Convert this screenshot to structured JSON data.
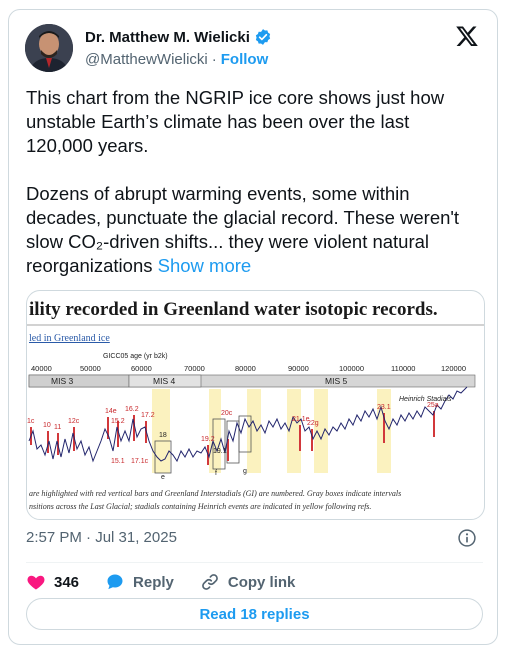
{
  "author": {
    "name": "Dr. Matthew M. Wielicki",
    "handle": "@MatthewWielicki",
    "separator": "·",
    "follow_label": "Follow"
  },
  "tweet": {
    "paragraph1": "This chart from the NGRIP ice core shows just how unstable Earth’s climate has been over the last 120,000 years.",
    "paragraph2": "Dozens of abrupt warming events, some within decades, punctuate the glacial record. These weren't slow CO₂-driven shifts... they were violent natural reorganizations",
    "show_more": "Show more"
  },
  "media": {
    "headline": "ility recorded in Greenland water isotopic records.",
    "subhead": "led in Greenland ice",
    "age_axis_label": "GICC05 age (yr b2k)",
    "age_ticks": [
      "40000",
      "50000",
      "60000",
      "70000",
      "80000",
      "90000",
      "100000",
      "110000",
      "120000"
    ],
    "stages": [
      "MIS 3",
      "MIS 4",
      "MIS 5"
    ],
    "annotation": "Heinrich Stadials",
    "interstadials": [
      "1c",
      "10",
      "11",
      "12c",
      "14e",
      "15.2",
      "16.2",
      "17.2",
      "19.2",
      "20c",
      "21.1e",
      "22g",
      "23.1",
      "25a",
      "15.1",
      "17.1c",
      "18",
      "19.1",
      "e",
      "f",
      "g"
    ],
    "caption1": " are highlighted with red vertical bars and Greenland Interstadials (GI) are numbered.  Gray boxes indicate intervals",
    "caption2": "nsitions across the Last Glacial; stadials containing Heinrich events are indicated in yellow following refs."
  },
  "meta": {
    "timestamp": "2:57 PM · Jul 31, 2025"
  },
  "actions": {
    "likes": "346",
    "reply_label": "Reply",
    "copy_link_label": "Copy link",
    "read_replies": "Read 18 replies"
  },
  "colors": {
    "accent": "#1d9bf0",
    "like": "#f91880",
    "verified": "#1d9bf0"
  }
}
